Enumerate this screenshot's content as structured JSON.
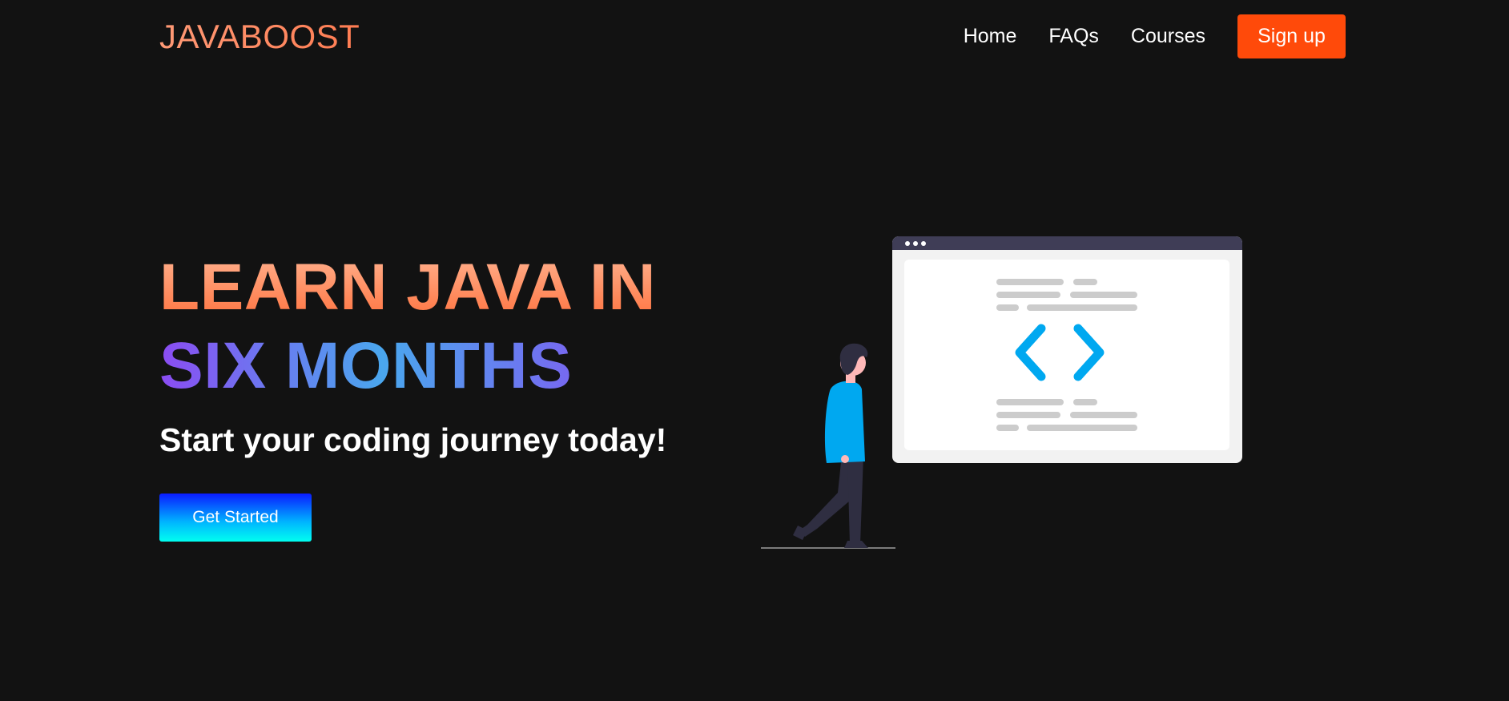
{
  "navbar": {
    "logo": "JAVABOOST",
    "links": [
      "Home",
      "FAQs",
      "Courses"
    ],
    "signup_label": "Sign up"
  },
  "hero": {
    "title_line1": "LEARN JAVA IN",
    "title_line2": "SIX MONTHS",
    "subtitle": "Start your coding journey today!",
    "cta_label": "Get Started"
  },
  "colors": {
    "background": "#121212",
    "signup": "#ff4a0a",
    "accent_orange": "#ff7c52",
    "accent_purple": "#8b4cf2",
    "accent_blue": "#00a8f0"
  }
}
